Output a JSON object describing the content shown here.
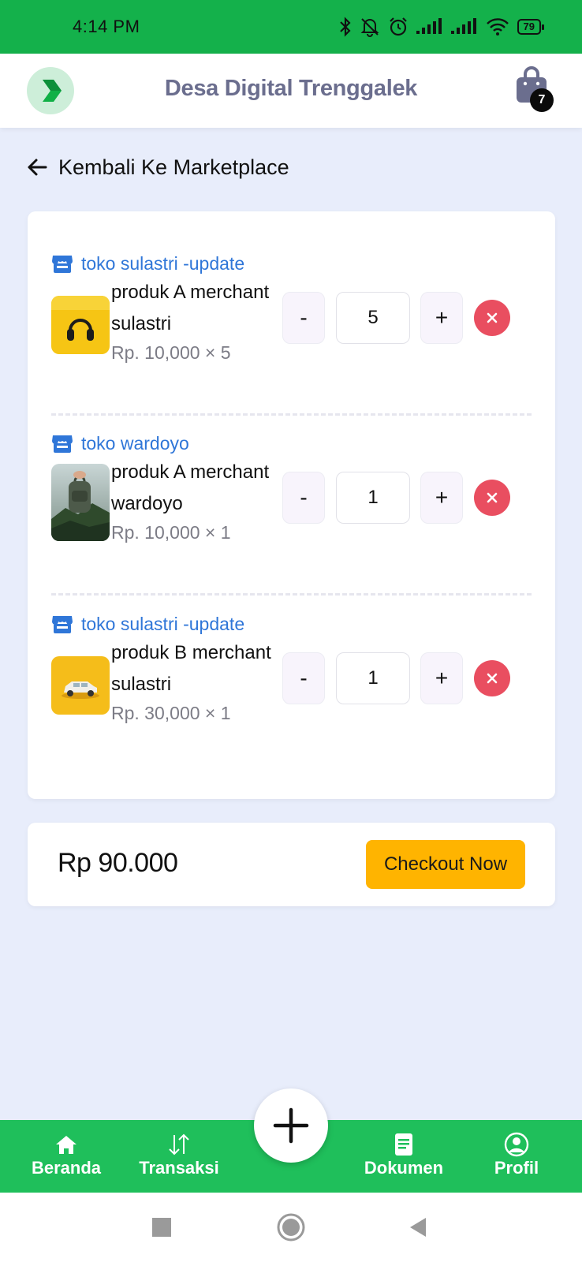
{
  "status_bar": {
    "time": "4:14 PM",
    "battery": "79"
  },
  "header": {
    "title": "Desa Digital Trenggalek",
    "cart_count": "7",
    "logo": "desa-digital-logo"
  },
  "back_link": {
    "label": "Kembali Ke Marketplace"
  },
  "cart": {
    "items": [
      {
        "store": "toko sulastri -update",
        "name": "produk A merchant sulastri",
        "price_line": "Rp. 10,000 × 5",
        "quantity": "5",
        "thumb": "yellow-headphones"
      },
      {
        "store": "toko wardoyo",
        "name": "produk A merchant wardoyo",
        "price_line": "Rp. 10,000 × 1",
        "quantity": "1",
        "thumb": "backpack-mountain"
      },
      {
        "store": "toko sulastri -update",
        "name": "produk B merchant sulastri",
        "price_line": "Rp. 30,000 × 1",
        "quantity": "1",
        "thumb": "yellow-car"
      }
    ],
    "minus_label": "-",
    "plus_label": "+"
  },
  "summary": {
    "total": "Rp 90.000",
    "checkout_label": "Checkout Now"
  },
  "bottom_nav": {
    "items": [
      {
        "label": "Beranda",
        "icon": "home-icon"
      },
      {
        "label": "Transaksi",
        "icon": "transfer-icon"
      },
      {
        "label": "Dokumen",
        "icon": "document-icon"
      },
      {
        "label": "Profil",
        "icon": "profile-icon"
      }
    ],
    "fab_icon": "plus-icon"
  },
  "colors": {
    "brand_green": "#14b14b",
    "nav_green": "#1fbf5b",
    "store_blue": "#2f76d8",
    "checkout_yellow": "#ffb400",
    "remove_red": "#e94e60",
    "background": "#e8edfb"
  }
}
